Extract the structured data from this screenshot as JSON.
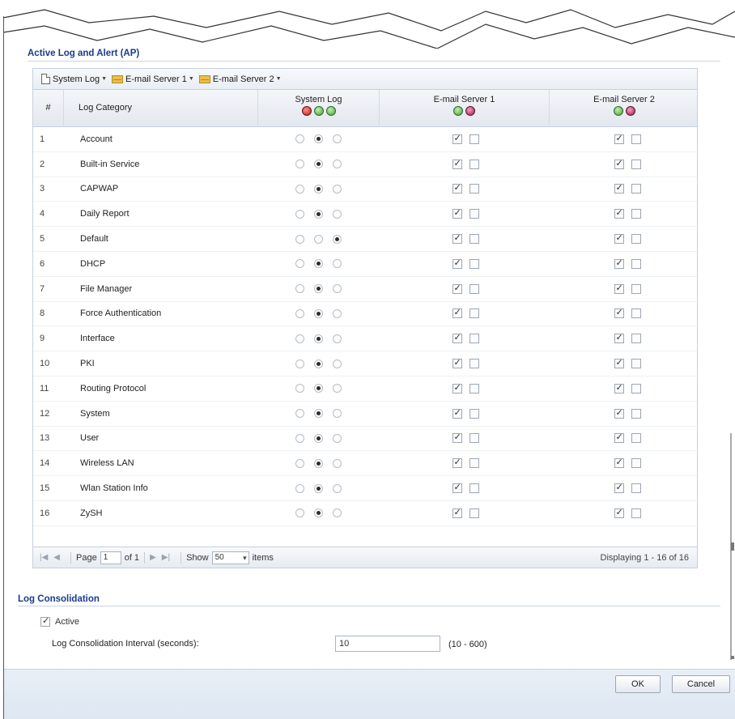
{
  "section_active_log": {
    "title": "Active Log and Alert (AP)"
  },
  "toolbar": {
    "items": [
      {
        "label": "System Log",
        "icon": "document-icon"
      },
      {
        "label": "E-mail Server 1",
        "icon": "mail-folder-icon"
      },
      {
        "label": "E-mail Server 2",
        "icon": "mail-folder-icon"
      }
    ]
  },
  "table": {
    "headers": {
      "num": "#",
      "category": "Log Category",
      "system_log": "System Log",
      "email1": "E-mail Server 1",
      "email2": "E-mail Server 2"
    },
    "header_icons": {
      "system_log": [
        "disable-icon",
        "enable-normal-icon",
        "enable-debug-icon"
      ],
      "email": [
        "alert-enable-icon",
        "alert-disable-icon"
      ]
    },
    "rows": [
      {
        "num": "1",
        "category": "Account",
        "sys": 1,
        "em1": [
          true,
          false
        ],
        "em2": [
          true,
          false
        ]
      },
      {
        "num": "2",
        "category": "Built-in Service",
        "sys": 1,
        "em1": [
          true,
          false
        ],
        "em2": [
          true,
          false
        ]
      },
      {
        "num": "3",
        "category": "CAPWAP",
        "sys": 1,
        "em1": [
          true,
          false
        ],
        "em2": [
          true,
          false
        ]
      },
      {
        "num": "4",
        "category": "Daily Report",
        "sys": 1,
        "em1": [
          true,
          false
        ],
        "em2": [
          true,
          false
        ]
      },
      {
        "num": "5",
        "category": "Default",
        "sys": 2,
        "em1": [
          true,
          false
        ],
        "em2": [
          true,
          false
        ]
      },
      {
        "num": "6",
        "category": "DHCP",
        "sys": 1,
        "em1": [
          true,
          false
        ],
        "em2": [
          true,
          false
        ]
      },
      {
        "num": "7",
        "category": "File Manager",
        "sys": 1,
        "em1": [
          true,
          false
        ],
        "em2": [
          true,
          false
        ]
      },
      {
        "num": "8",
        "category": "Force Authentication",
        "sys": 1,
        "em1": [
          true,
          false
        ],
        "em2": [
          true,
          false
        ]
      },
      {
        "num": "9",
        "category": "Interface",
        "sys": 1,
        "em1": [
          true,
          false
        ],
        "em2": [
          true,
          false
        ]
      },
      {
        "num": "10",
        "category": "PKI",
        "sys": 1,
        "em1": [
          true,
          false
        ],
        "em2": [
          true,
          false
        ]
      },
      {
        "num": "11",
        "category": "Routing Protocol",
        "sys": 1,
        "em1": [
          true,
          false
        ],
        "em2": [
          true,
          false
        ]
      },
      {
        "num": "12",
        "category": "System",
        "sys": 1,
        "em1": [
          true,
          false
        ],
        "em2": [
          true,
          false
        ]
      },
      {
        "num": "13",
        "category": "User",
        "sys": 1,
        "em1": [
          true,
          false
        ],
        "em2": [
          true,
          false
        ]
      },
      {
        "num": "14",
        "category": "Wireless LAN",
        "sys": 1,
        "em1": [
          true,
          false
        ],
        "em2": [
          true,
          false
        ]
      },
      {
        "num": "15",
        "category": "Wlan Station Info",
        "sys": 1,
        "em1": [
          true,
          false
        ],
        "em2": [
          true,
          false
        ]
      },
      {
        "num": "16",
        "category": "ZySH",
        "sys": 1,
        "em1": [
          true,
          false
        ],
        "em2": [
          true,
          false
        ]
      }
    ]
  },
  "pager": {
    "page_label": "Page",
    "page_value": "1",
    "of_label": "of 1",
    "show_label": "Show",
    "show_value": "50",
    "items_label": "items",
    "display_text": "Displaying 1 - 16 of 16"
  },
  "consolidation": {
    "title": "Log Consolidation",
    "active_label": "Active",
    "active_checked": true,
    "interval_label": "Log Consolidation Interval (seconds):",
    "interval_value": "10",
    "interval_range": "(10 - 600)"
  },
  "buttons": {
    "ok": "OK",
    "cancel": "Cancel"
  }
}
